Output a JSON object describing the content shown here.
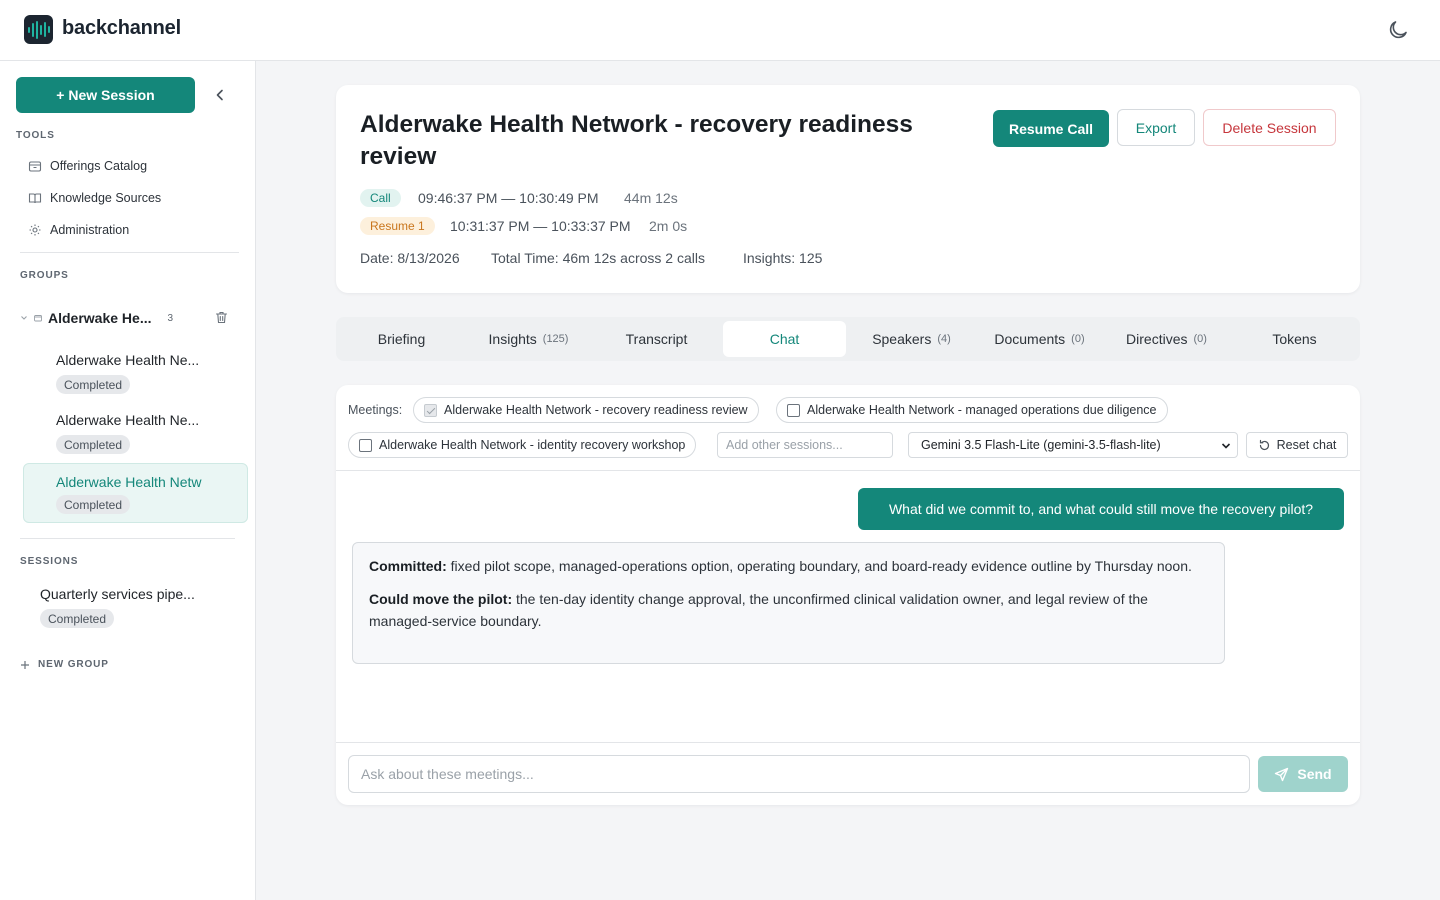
{
  "app": {
    "brand": "backchannel"
  },
  "sidebar": {
    "new_session_label": "+ New Session",
    "tools_heading": "TOOLS",
    "tools": [
      {
        "label": "Offerings Catalog",
        "icon": "box-icon"
      },
      {
        "label": "Knowledge Sources",
        "icon": "book-icon"
      },
      {
        "label": "Administration",
        "icon": "gear-icon"
      }
    ],
    "groups_heading": "GROUPS",
    "group": {
      "name": "Alderwake He...",
      "count": "3"
    },
    "group_sessions": [
      {
        "title": "Alderwake Health Ne...",
        "status": "Completed"
      },
      {
        "title": "Alderwake Health Ne...",
        "status": "Completed"
      },
      {
        "title": "Alderwake Health Netw",
        "status": "Completed"
      }
    ],
    "sessions_heading": "SESSIONS",
    "sessions": [
      {
        "title": "Quarterly services pipe...",
        "status": "Completed"
      }
    ],
    "new_group_label": "NEW GROUP"
  },
  "header": {
    "title": "Alderwake Health Network - recovery readiness review",
    "resume_call_label": "Resume Call",
    "export_label": "Export",
    "delete_label": "Delete Session",
    "calls": [
      {
        "tag": "Call",
        "range": "09:46:37 PM — 10:30:49 PM",
        "duration": "44m 12s"
      },
      {
        "tag": "Resume 1",
        "range": "10:31:37 PM — 10:33:37 PM",
        "duration": "2m 0s"
      }
    ],
    "date": "Date: 8/13/2026",
    "total_time": "Total Time: 46m 12s across 2 calls",
    "insights": "Insights: 125"
  },
  "tabs": [
    {
      "label": "Briefing",
      "count": ""
    },
    {
      "label": "Insights",
      "count": "(125)"
    },
    {
      "label": "Transcript",
      "count": ""
    },
    {
      "label": "Chat",
      "count": ""
    },
    {
      "label": "Speakers",
      "count": "(4)"
    },
    {
      "label": "Documents",
      "count": "(0)"
    },
    {
      "label": "Directives",
      "count": "(0)"
    },
    {
      "label": "Tokens",
      "count": ""
    }
  ],
  "active_tab": "Chat",
  "chat": {
    "meetings_label": "Meetings:",
    "meetings": [
      {
        "label": "Alderwake Health Network - recovery readiness review",
        "checked": true
      },
      {
        "label": "Alderwake Health Network - managed operations due diligence",
        "checked": false
      },
      {
        "label": "Alderwake Health Network - identity recovery workshop",
        "checked": false
      }
    ],
    "add_sessions_placeholder": "Add other sessions...",
    "model_selected": "Gemini 3.5 Flash-Lite (gemini-3.5-flash-lite)",
    "reset_label": "Reset chat",
    "user_message": "What did we commit to, and what could still move the recovery pilot?",
    "assistant": {
      "p1_label": "Committed:",
      "p1_text": " fixed pilot scope, managed-operations option, operating boundary, and board-ready evidence outline by Thursday noon.",
      "p2_label": "Could move the pilot:",
      "p2_text": " the ten-day identity change approval, the unconfirmed clinical validation owner, and legal review of the managed-service boundary."
    },
    "ask_placeholder": "Ask about these meetings...",
    "send_label": "Send"
  },
  "colors": {
    "accent": "#14877a",
    "danger": "#c6363c",
    "resume_badge": "#c9761d",
    "send_disabled": "#9fd3cc"
  }
}
